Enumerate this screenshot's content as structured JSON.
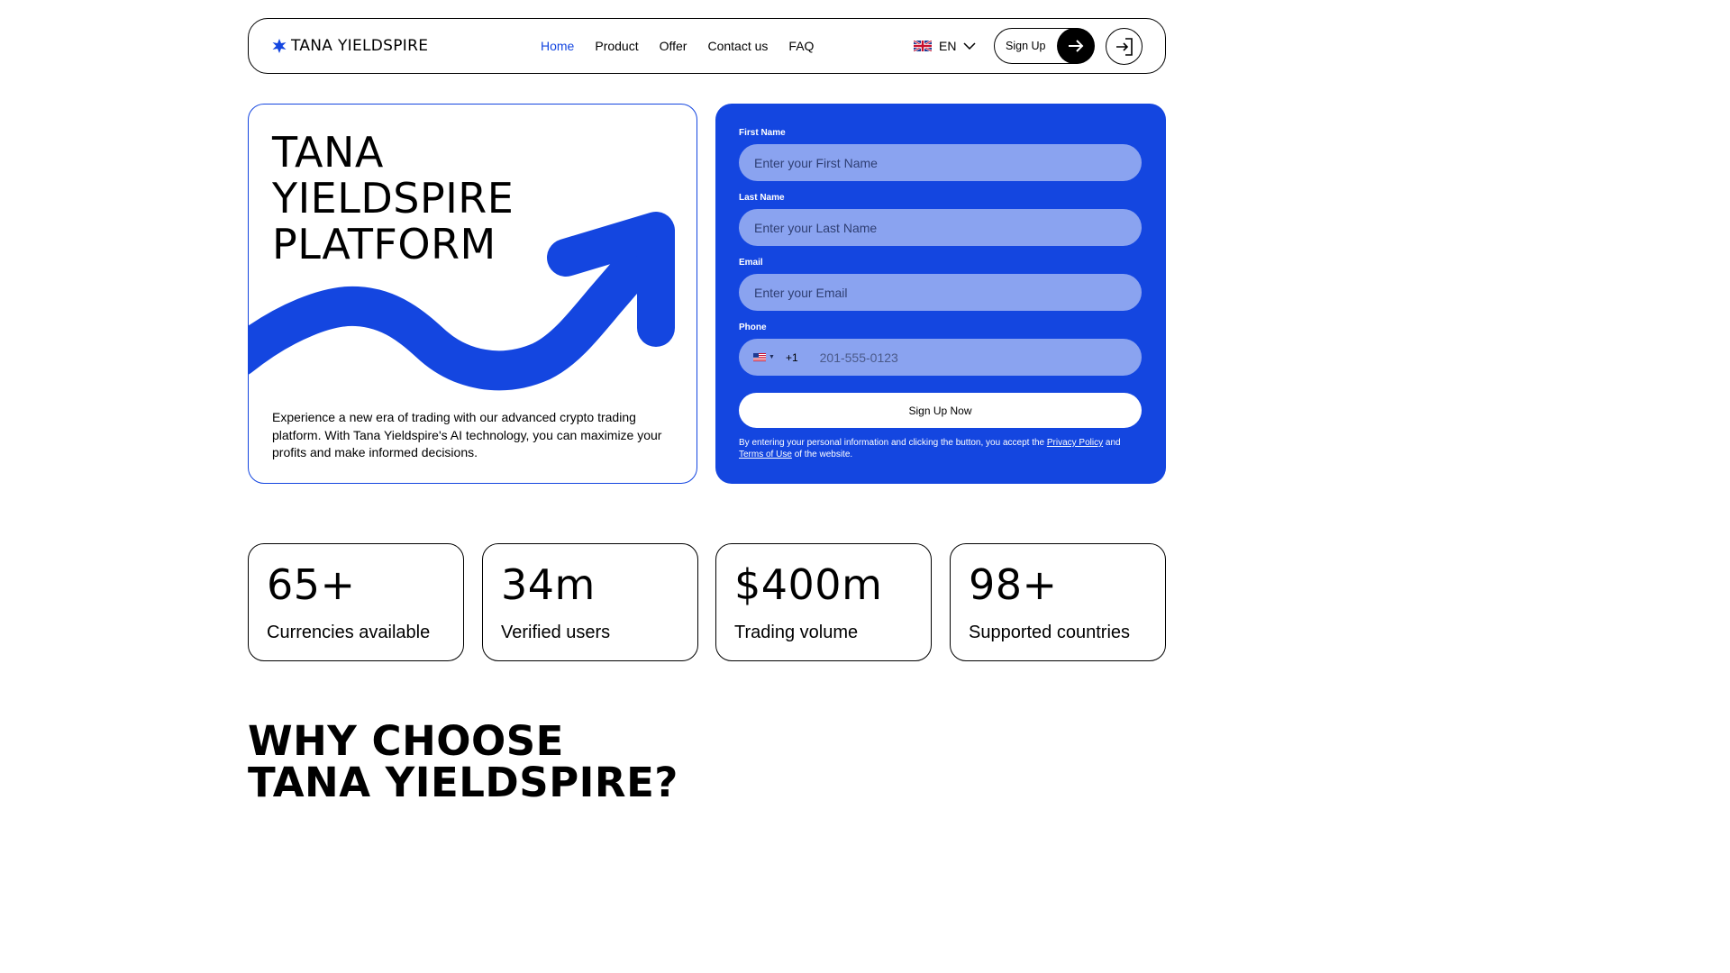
{
  "brand": {
    "name": "TANA YIELDSPIRE",
    "accent": "#1446e0"
  },
  "nav": {
    "items": [
      {
        "label": "Home",
        "active": true
      },
      {
        "label": "Product"
      },
      {
        "label": "Offer"
      },
      {
        "label": "Contact us"
      },
      {
        "label": "FAQ"
      }
    ]
  },
  "language": {
    "code": "EN",
    "flag_icon": "uk-flag-icon"
  },
  "header_actions": {
    "signup_label": "Sign Up",
    "login_icon": "login-icon"
  },
  "hero": {
    "title_lines": [
      "TANA",
      "YIELDSPIRE",
      "PLATFORM"
    ],
    "description": "Experience a new era of trading with our advanced crypto trading platform. With Tana Yieldspire's AI technology, you can maximize your profits and make informed decisions."
  },
  "form": {
    "first_name": {
      "label": "First Name",
      "placeholder": "Enter your First Name"
    },
    "last_name": {
      "label": "Last Name",
      "placeholder": "Enter your Last Name"
    },
    "email": {
      "label": "Email",
      "placeholder": "Enter your Email"
    },
    "phone": {
      "label": "Phone",
      "dial_code": "+1",
      "placeholder": "201-555-0123",
      "flag_icon": "us-flag-icon"
    },
    "submit_label": "Sign Up Now",
    "disclaimer_prefix": "By entering your personal information and clicking the button, you accept the",
    "privacy_link": "Privacy Policy",
    "disclaimer_and": "and",
    "terms_link": "Terms of Use",
    "disclaimer_suffix": "of the website."
  },
  "stats": [
    {
      "value": "65+",
      "label": "Currencies available"
    },
    {
      "value": "34m",
      "label": "Verified users"
    },
    {
      "value": "$400m",
      "label": "Trading volume"
    },
    {
      "value": "98+",
      "label": "Supported countries"
    }
  ],
  "why": {
    "title_lines": [
      "WHY CHOOSE",
      "TANA YIELDSPIRE?"
    ]
  }
}
